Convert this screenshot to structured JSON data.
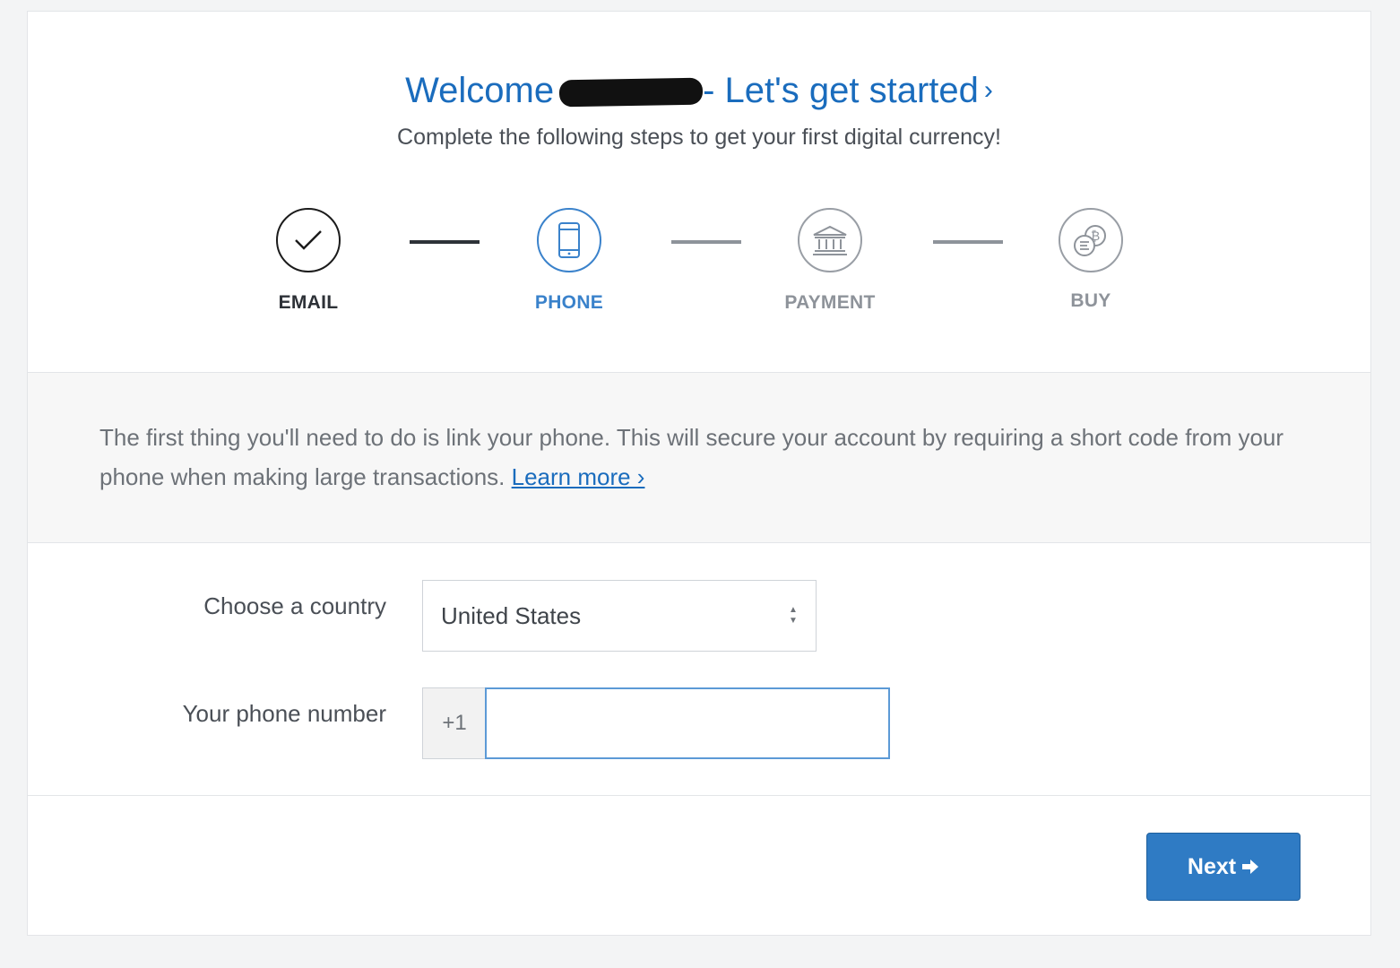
{
  "header": {
    "title_prefix": "Welcome",
    "title_suffix": "- Let's get started",
    "title_chevron": "›",
    "subtitle": "Complete the following steps to get your first digital currency!"
  },
  "steps": [
    {
      "label": "EMAIL",
      "icon": "checkmark-icon",
      "state": "complete",
      "color": "#1b1b1b"
    },
    {
      "label": "PHONE",
      "icon": "mobile-phone-icon",
      "state": "active",
      "color": "#3a82cb"
    },
    {
      "label": "PAYMENT",
      "icon": "bank-icon",
      "state": "pending",
      "color": "#8e939a"
    },
    {
      "label": "BUY",
      "icon": "bitcoin-coins-icon",
      "state": "pending",
      "color": "#8e939a"
    }
  ],
  "info": {
    "text": "The first thing you'll need to do is link your phone. This will secure your account by requiring a short code from your phone when making large transactions.",
    "learn_more": "Learn more ›"
  },
  "form": {
    "country_label": "Choose a country",
    "country_value": "United States",
    "phone_label": "Your phone number",
    "phone_prefix": "+1",
    "phone_value": ""
  },
  "footer": {
    "next_label": "Next"
  },
  "colors": {
    "brand_blue": "#1a6cbd",
    "button_blue": "#2f7bc4"
  }
}
